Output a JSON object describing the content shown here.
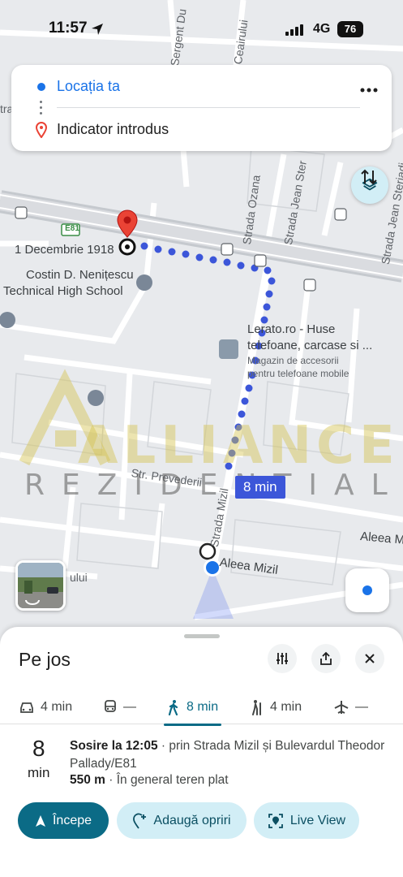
{
  "status_bar": {
    "time": "11:57",
    "network": "4G",
    "battery": "76"
  },
  "directions": {
    "origin": "Locația ta",
    "destination": "Indicator introdus"
  },
  "map": {
    "street_labels": {
      "sergent": "Sergent Du",
      "ceairului": "Ceairului",
      "ozana": "Strada Ozana",
      "jean_ster_1": "Strada Jean Ster",
      "jean_ster_2": "Strada Jean Steriadi",
      "e81": "E81",
      "prevederii": "Str. Prevederii",
      "mizil": "Strada Mizil",
      "aleea_mizil": "Aleea Mizil",
      "aleea_mizil_2": "Aleea M",
      "tra": "tra",
      "ului": "ului"
    },
    "places": {
      "decembrie": "1 Decembrie 1918",
      "school_line1": "Costin D. Nenițescu",
      "school_line2": "Technical High School",
      "shop_line1": "Lerato.ro - Huse",
      "shop_line2": "telefoane, carcase si ...",
      "shop_desc1": "Magazin de accesorii",
      "shop_desc2": "pentru telefoane mobile"
    },
    "eta_badge": "8 min",
    "watermark": {
      "main": "ALLIANCE",
      "sub": "REZIDENTIAL"
    }
  },
  "sheet": {
    "title": "Pe jos",
    "modes": [
      {
        "label": "4 min",
        "icon": "car-icon"
      },
      {
        "label": "—",
        "icon": "transit-icon"
      },
      {
        "label": "8 min",
        "icon": "walk-icon",
        "active": true
      },
      {
        "label": "4 min",
        "icon": "ride-icon"
      },
      {
        "label": "—",
        "icon": "flight-icon"
      }
    ],
    "route": {
      "minutes": "8",
      "minutes_unit": "min",
      "arrival": "Sosire la 12:05",
      "via": " · prin Strada Mizil și Bulevardul Theodor Pallady/E81",
      "distance": "550 m",
      "terrain": " · În general teren plat"
    },
    "buttons": {
      "start": "Începe",
      "add_stops": "Adaugă opriri",
      "live_view": "Live View"
    }
  },
  "colors": {
    "accent": "#0b6b86",
    "route": "#3c56d9",
    "pin": "#ea4335",
    "blue": "#1a73e8"
  }
}
